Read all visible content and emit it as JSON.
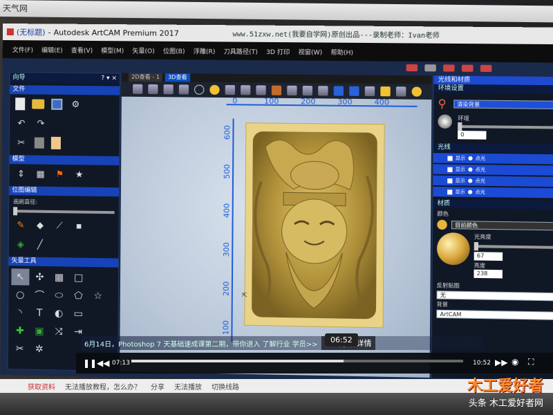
{
  "browser": {
    "top_label": "天气网"
  },
  "window": {
    "doc_title": "(无标题)",
    "app_title": "Autodesk ArtCAM Premium 2017",
    "watermark": "www.51zxw.net(我要自学网)原创出品---录制老师：Ivan老师"
  },
  "menubar": {
    "items": [
      "文件(F)",
      "编辑(E)",
      "查看(V)",
      "模型(M)",
      "矢量(O)",
      "位图(B)",
      "浮雕(R)",
      "刀具路径(T)",
      "3D 打印",
      "视窗(W)",
      "帮助(H)"
    ]
  },
  "left_panel": {
    "title": "向导",
    "controls": "? ▾ ×",
    "sections": {
      "file": "文件",
      "model": "模型",
      "bitmap": "位图编辑",
      "vector": "矢量工具"
    },
    "brush_label": "画刷直径:"
  },
  "view": {
    "tabs": [
      "2D查看 - 1",
      "3D查看"
    ],
    "active_tab": 1,
    "ruler_top": [
      "0",
      "100",
      "200",
      "300",
      "400"
    ],
    "ruler_left": [
      "600",
      "500",
      "400",
      "300",
      "200",
      "100"
    ]
  },
  "right_panel": {
    "title": "光线和材质",
    "env_section": "环境设置",
    "env_select": "渲染背景",
    "ambient_label": "环境",
    "ambient_value": "0",
    "lights_section": "光线",
    "lights": [
      {
        "label1": "显示",
        "label2": "点光"
      },
      {
        "label1": "显示",
        "label2": "点光"
      },
      {
        "label1": "显示",
        "label2": "点光"
      },
      {
        "label1": "显示",
        "label2": "点光"
      }
    ],
    "material_section": "材质",
    "color_label": "颜色",
    "color_value": "目前颜色",
    "gloss_label": "光亮度",
    "gloss_value": "67",
    "contrast_label": "亮度",
    "contrast_value": "238",
    "reflection_label": "反射贴图",
    "reflection_value": "无",
    "background_label": "背景",
    "background_value": "ArtCAM"
  },
  "player": {
    "subtitle": "6月14日，Photoshop 7 天基础速成课第二期，带你进入 了解行业 学员>>",
    "cta": "点击了解详情",
    "hover_time": "06:52",
    "current_time": "07:13",
    "total_time": "10:52",
    "progress": 0.64
  },
  "bottom_bar": {
    "items": [
      "获取资料",
      "无法播放教程，怎么办？",
      "分享",
      "无法播放",
      "切换线路"
    ]
  },
  "brand": {
    "logo": "木工爱好者",
    "caption": "头条  木工爱好者网"
  },
  "colors": {
    "accent_blue": "#1743b8",
    "relief_gold": "#c9a84d",
    "viewport_bg": "#c7d2de"
  }
}
